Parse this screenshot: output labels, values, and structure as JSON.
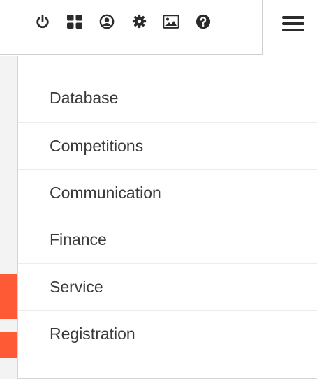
{
  "toolbar": {
    "icons": [
      "power-icon",
      "grid-icon",
      "user-icon",
      "gear-icon",
      "image-icon",
      "help-icon"
    ]
  },
  "menu": {
    "items": [
      {
        "label": "Database"
      },
      {
        "label": "Competitions"
      },
      {
        "label": "Communication"
      },
      {
        "label": "Finance"
      },
      {
        "label": "Service"
      },
      {
        "label": "Registration"
      }
    ]
  },
  "colors": {
    "accent": "#ff5a36",
    "icon": "#2b2b2b",
    "text": "#3a3a3a"
  }
}
